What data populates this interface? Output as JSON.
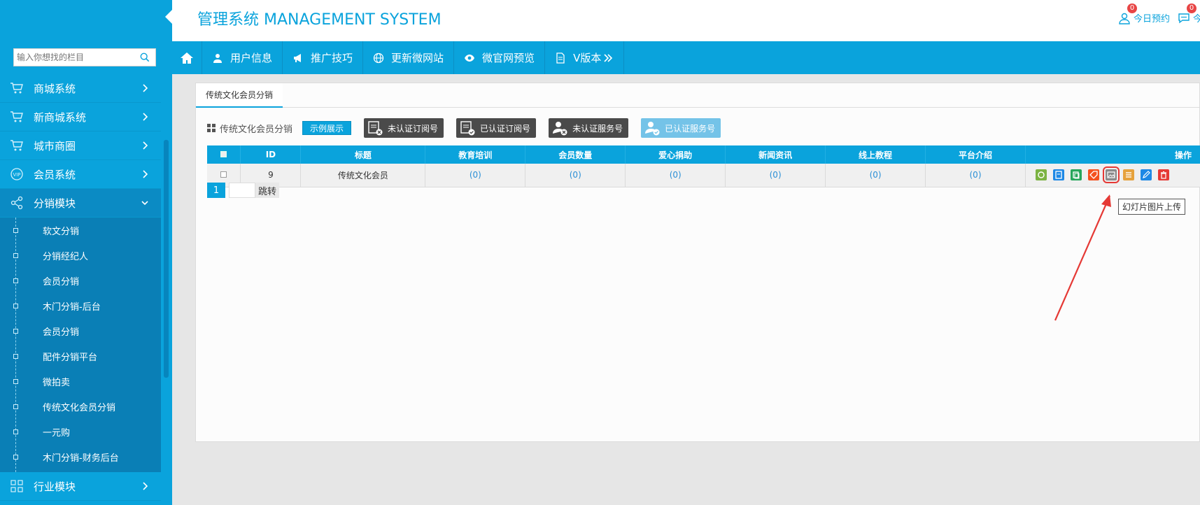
{
  "brand": {
    "title": "管理系统 MANAGEMENT SYSTEM"
  },
  "header_links": [
    {
      "label": "今日预约",
      "badge": "0",
      "icon": "user-icon"
    },
    {
      "label": "今",
      "badge": "0",
      "icon": "chat-icon"
    }
  ],
  "search": {
    "placeholder": "输入你想找的栏目",
    "icon": "search-icon"
  },
  "sidebar": {
    "items": [
      {
        "label": "商城系统",
        "icon": "cart-icon"
      },
      {
        "label": "新商城系统",
        "icon": "cart-icon"
      },
      {
        "label": "城市商圈",
        "icon": "cart-icon"
      },
      {
        "label": "会员系统",
        "icon": "vip-icon"
      },
      {
        "label": "分销模块",
        "icon": "share-icon",
        "open": true
      },
      {
        "label": "行业模块",
        "icon": "grid-icon"
      }
    ],
    "subitems": [
      "软文分销",
      "分销经纪人",
      "会员分销",
      "木门分销-后台",
      "会员分销",
      "配件分销平台",
      "微拍卖",
      "传统文化会员分销",
      "一元购",
      "木门分销-财务后台"
    ]
  },
  "nav": {
    "items": [
      {
        "label": "用户信息",
        "icon": "user-icon"
      },
      {
        "label": "推广技巧",
        "icon": "megaphone-icon"
      },
      {
        "label": "更新微网站",
        "icon": "globe-icon"
      },
      {
        "label": "微官网预览",
        "icon": "eye-icon"
      },
      {
        "label": "V版本",
        "icon": "doc-icon"
      }
    ]
  },
  "tab": {
    "label": "传统文化会员分销"
  },
  "toolbar": {
    "title": "传统文化会员分销",
    "demo_label": "示例展示",
    "buttons": [
      {
        "label": "未认证订阅号"
      },
      {
        "label": "已认证订阅号"
      },
      {
        "label": "未认证服务号"
      },
      {
        "label": "已认证服务号"
      }
    ]
  },
  "table": {
    "headers": [
      "",
      "ID",
      "标题",
      "教育培训",
      "会员数量",
      "爱心捐助",
      "新闻资讯",
      "线上教程",
      "平台介绍",
      "操作"
    ],
    "rows": [
      {
        "id": "9",
        "title": "传统文化会员",
        "values": [
          "(0)",
          "(0)",
          "(0)",
          "(0)",
          "(0)",
          "(0)"
        ]
      }
    ],
    "op_colors": [
      "#7cb342",
      "#1e88e5",
      "#26a65b",
      "#f4511e",
      "#8a8a8a",
      "#e6a23c",
      "#1e88e5",
      "#e53935"
    ]
  },
  "pager": {
    "page": "1",
    "go_label": "跳转"
  },
  "tooltip": {
    "text": "幻灯片图片上传"
  }
}
